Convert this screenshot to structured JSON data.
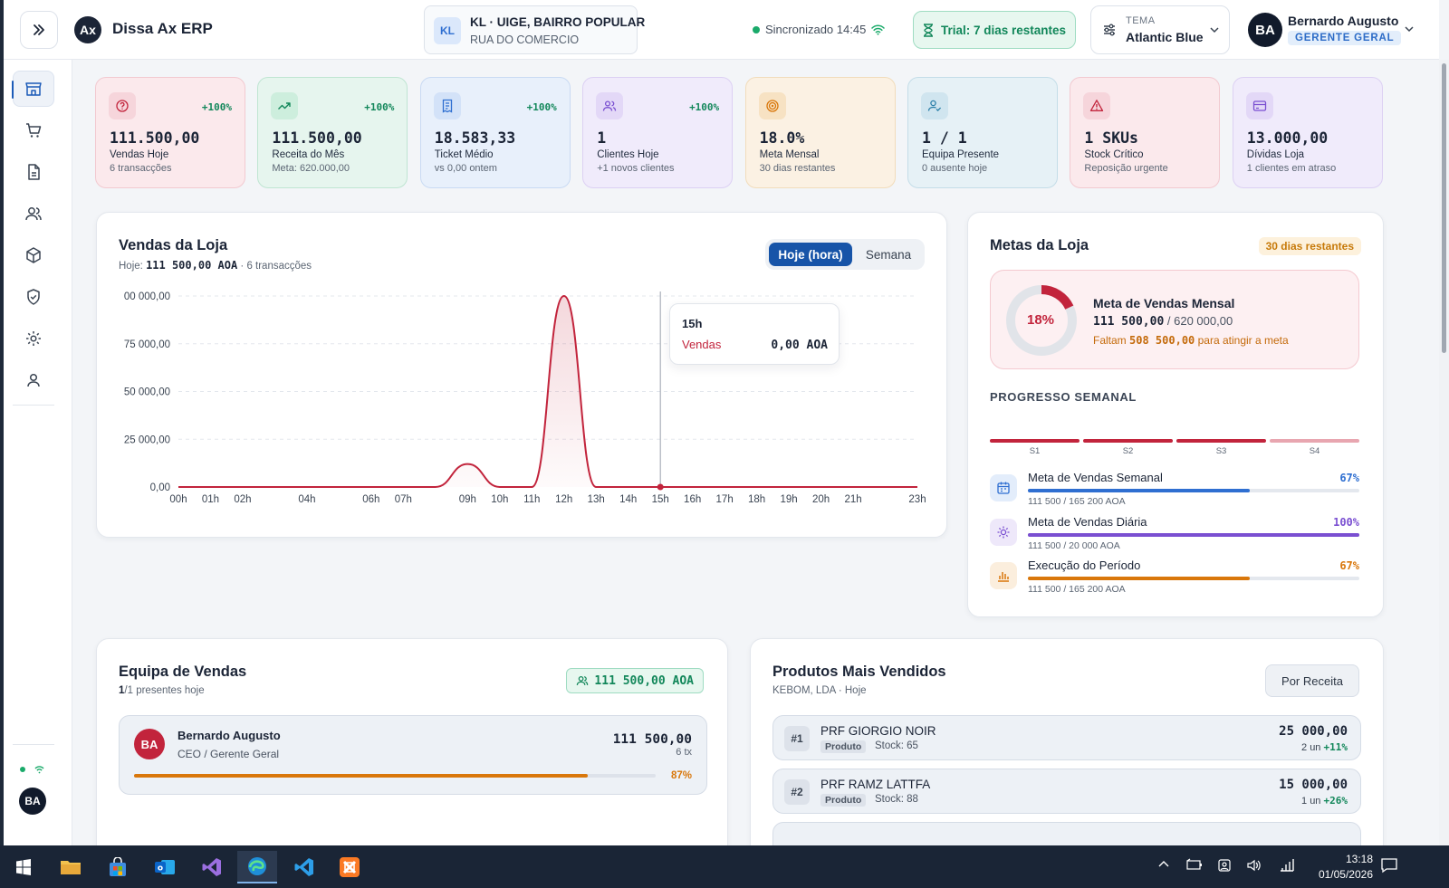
{
  "header": {
    "app_title": "Dissa Ax ERP",
    "logo_text": "Ax",
    "store": {
      "badge": "KL",
      "name": "KL · UIGE, BAIRRO POPULAR",
      "street": "RUA DO COMERCIO"
    },
    "sync_status": "Sincronizado 14:45",
    "trial": "Trial: 7 dias restantes",
    "theme": {
      "label": "TEMA",
      "value": "Atlantic Blue"
    },
    "user": {
      "initials": "BA",
      "name": "Bernardo Augusto",
      "role": "GERENTE GERAL"
    }
  },
  "sidebar": {
    "items": [
      {
        "icon": "store-icon",
        "active": true
      },
      {
        "icon": "cart-icon",
        "active": false
      },
      {
        "icon": "document-icon",
        "active": false
      },
      {
        "icon": "users-icon",
        "active": false
      },
      {
        "icon": "box-icon",
        "active": false
      },
      {
        "icon": "shield-icon",
        "active": false
      },
      {
        "icon": "gear-icon",
        "active": false
      },
      {
        "icon": "user-icon",
        "active": false
      }
    ],
    "avatar": "BA"
  },
  "kpis": [
    {
      "value": "111.500,00",
      "label": "Vendas Hoje",
      "sub": "6 transacções",
      "change": "+100%",
      "icon": "question-icon",
      "bg": "#fbe9ec",
      "border": "#f2c9d0",
      "icon_bg": "#f6d5db",
      "icon_color": "#c2243c"
    },
    {
      "value": "111.500,00",
      "label": "Receita do Mês",
      "sub": "Meta: 620.000,00",
      "change": "+100%",
      "icon": "trend-up-icon",
      "bg": "#e6f5ee",
      "border": "#bfe5d2",
      "icon_bg": "#cdeedd",
      "icon_color": "#12875a"
    },
    {
      "value": "18.583,33",
      "label": "Ticket Médio",
      "sub": "vs 0,00 ontem",
      "change": "+100%",
      "icon": "receipt-icon",
      "bg": "#e8f0fb",
      "border": "#c9daf3",
      "icon_bg": "#d3e2f8",
      "icon_color": "#2f6fd1"
    },
    {
      "value": "1",
      "label": "Clientes Hoje",
      "sub": "+1 novos clientes",
      "change": "+100%",
      "icon": "users-icon",
      "bg": "#f0ebfb",
      "border": "#dcd0f3",
      "icon_bg": "#e3d8f7",
      "icon_color": "#7a4fd1"
    },
    {
      "value": "18.0%",
      "label": "Meta Mensal",
      "sub": "30 dias restantes",
      "change": "",
      "icon": "target-icon",
      "bg": "#fbf1e3",
      "border": "#f1dcbb",
      "icon_bg": "#f7e2c3",
      "icon_color": "#d9770b"
    },
    {
      "value": "1 / 1",
      "label": "Equipa Presente",
      "sub": "0 ausente hoje",
      "change": "",
      "icon": "user-check-icon",
      "bg": "#e6f1f6",
      "border": "#c4dde8",
      "icon_bg": "#d0e5ef",
      "icon_color": "#2a7fa8"
    },
    {
      "value": "1 SKUs",
      "label": "Stock Crítico",
      "sub": "Reposição urgente",
      "change": "",
      "icon": "warning-icon",
      "bg": "#fbe9ec",
      "border": "#f2c9d0",
      "icon_bg": "#f6d5db",
      "icon_color": "#c2243c"
    },
    {
      "value": "13.000,00",
      "label": "Dívidas Loja",
      "sub": "1 clientes em atraso",
      "change": "",
      "icon": "card-icon",
      "bg": "#f0ebfb",
      "border": "#dcd0f3",
      "icon_bg": "#e3d8f7",
      "icon_color": "#7a4fd1"
    }
  ],
  "sales": {
    "title": "Vendas da Loja",
    "sub_prefix": "Hoje:",
    "sub_value": "111 500,00 AOA",
    "sub_suffix": "· 6 transacções",
    "seg_on": "Hoje (hora)",
    "seg_off": "Semana",
    "tooltip": {
      "title": "15h",
      "label": "Vendas",
      "value": "0,00 AOA"
    }
  },
  "chart_data": {
    "type": "area",
    "series": [
      {
        "name": "Vendas",
        "values": [
          0,
          0,
          0,
          0,
          0,
          0,
          0,
          0,
          0,
          12000,
          0,
          0,
          100000,
          0,
          0,
          0,
          0,
          0,
          0,
          0,
          0,
          0,
          0,
          0
        ]
      }
    ],
    "x": [
      "00h",
      "01h",
      "02h",
      "03h",
      "04h",
      "05h",
      "06h",
      "07h",
      "08h",
      "09h",
      "10h",
      "11h",
      "12h",
      "13h",
      "14h",
      "15h",
      "16h",
      "17h",
      "18h",
      "19h",
      "20h",
      "21h",
      "22h",
      "23h"
    ],
    "x_tick_labels": [
      "00h",
      "01h",
      "02h",
      "04h",
      "06h",
      "07h",
      "09h",
      "10h",
      "11h",
      "12h",
      "13h",
      "14h",
      "15h",
      "16h",
      "17h",
      "18h",
      "19h",
      "20h",
      "21h",
      "23h"
    ],
    "y_ticks": [
      0,
      25000,
      50000,
      75000,
      100000
    ],
    "y_tick_labels": [
      "0,00",
      "25 000,00",
      "50 000,00",
      "75 000,00",
      "00 000,00"
    ],
    "ylim": [
      0,
      100000
    ],
    "highlight_x": "15h",
    "grid": true,
    "color": "#c2243c"
  },
  "goals": {
    "title": "Metas da Loja",
    "badge": "30 dias restantes",
    "monthly": {
      "pct_label": "18%",
      "pct": 18,
      "title": "Meta de Vendas Mensal",
      "value": "111 500,00",
      "target": "/ 620 000,00",
      "miss_prefix": "Faltam",
      "miss_value": "508 500,00",
      "miss_suffix": "para atingir a meta"
    },
    "weekly_label": "PROGRESSO SEMANAL",
    "weeks": [
      {
        "label": "S1",
        "color": "#c2243c"
      },
      {
        "label": "S2",
        "color": "#c2243c"
      },
      {
        "label": "S3",
        "color": "#c2243c"
      },
      {
        "label": "S4",
        "color": "#e8a6b0"
      }
    ],
    "metrics": [
      {
        "title": "Meta de Vendas Semanal",
        "pct_label": "67%",
        "pct": 67,
        "sub": "111 500 / 165 200 AOA",
        "color": "#2f6fd1",
        "icon": "calendar-icon",
        "icon_bg": "#e3edfb"
      },
      {
        "title": "Meta de Vendas Diária",
        "pct_label": "100%",
        "pct": 100,
        "sub": "111 500 / 20 000 AOA",
        "color": "#7a4fd1",
        "icon": "sun-icon",
        "icon_bg": "#eee8fa"
      },
      {
        "title": "Execução do Período",
        "pct_label": "67%",
        "pct": 67,
        "sub": "111 500 / 165 200 AOA",
        "color": "#d9770b",
        "icon": "bar-chart-icon",
        "icon_bg": "#fbeedd"
      }
    ]
  },
  "team": {
    "title": "Equipa de Vendas",
    "present_count": "1",
    "present_suffix": "/1 presentes hoje",
    "total": "111 500,00 AOA",
    "member": {
      "initials": "BA",
      "name": "Bernardo Augusto",
      "role": "CEO / Gerente Geral",
      "value": "111 500,00",
      "tx": "6 tx",
      "pct_label": "87%",
      "pct": 87
    }
  },
  "products": {
    "title": "Produtos Mais Vendidos",
    "sub": "KEBOM, LDA · Hoje",
    "sort": "Por Receita",
    "items": [
      {
        "rank": "#1",
        "name": "PRF GIORGIO NOIR",
        "tag": "Produto",
        "stock": "Stock: 65",
        "value": "25 000,00",
        "units": "2 un",
        "change": "+11%"
      },
      {
        "rank": "#2",
        "name": "PRF RAMZ LATTFA",
        "tag": "Produto",
        "stock": "Stock: 88",
        "value": "15 000,00",
        "units": "1 un",
        "change": "+26%"
      }
    ]
  },
  "taskbar": {
    "time": "13:18",
    "date": "01/05/2026"
  }
}
